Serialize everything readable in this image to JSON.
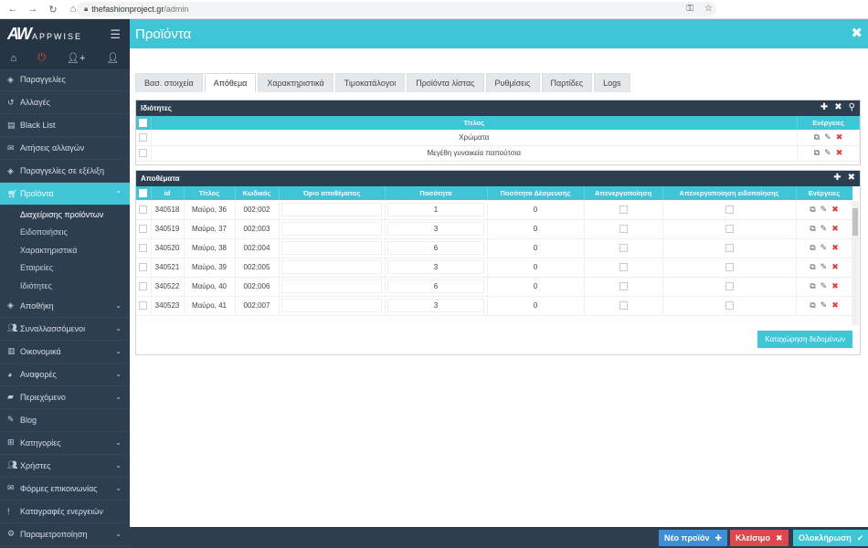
{
  "browser": {
    "url_host": "thefashionproject.gr",
    "url_path": "/admin"
  },
  "brand": {
    "mark": "AW",
    "word": "APPWISE"
  },
  "sidebar": {
    "items": [
      {
        "label": "Παραγγελίες",
        "icon": "cube-icon"
      },
      {
        "label": "Αλλαγές",
        "icon": "undo-icon"
      },
      {
        "label": "Black List",
        "icon": "list-icon"
      },
      {
        "label": "Αιτήσεις αλλαγών",
        "icon": "envelope-icon"
      },
      {
        "label": "Παραγγελίες σε εξέλιξη",
        "icon": "cube-icon"
      }
    ],
    "active": {
      "label": "Προϊόντα",
      "icon": "cart-icon"
    },
    "submenu": [
      "Διαχείρισης προϊόντων",
      "Ειδοποιήσεις",
      "Χαρακτηριστικά",
      "Εταιρείες",
      "Ιδιότητες"
    ],
    "items_after": [
      {
        "label": "Αποθήκη",
        "icon": "cube-icon",
        "chevron": true
      },
      {
        "label": "Συναλλασσόμενοι",
        "icon": "users-icon",
        "chevron": true
      },
      {
        "label": "Οικονομικά",
        "icon": "chart-icon",
        "chevron": true
      },
      {
        "label": "Αναφορές",
        "icon": "pie-icon",
        "chevron": true
      },
      {
        "label": "Περιεχόμενο",
        "icon": "folder-icon",
        "chevron": true
      },
      {
        "label": "Blog",
        "icon": "pencil-icon",
        "chevron": false
      },
      {
        "label": "Κατηγορίες",
        "icon": "sitemap-icon",
        "chevron": true
      },
      {
        "label": "Χρήστες",
        "icon": "users-icon",
        "chevron": true
      },
      {
        "label": "Φόρμες επικοινωνίας",
        "icon": "envelope-icon",
        "chevron": true
      },
      {
        "label": "Καταγραφές ενεργειών",
        "icon": "exclamation-icon",
        "chevron": false
      },
      {
        "label": "Παραμετροποίηση",
        "icon": "gears-icon",
        "chevron": true
      }
    ]
  },
  "header": {
    "title": "Προϊόντα"
  },
  "tabs": [
    "Βασ. στοιχεία",
    "Απόθεμα",
    "Χαρακτηριστικά",
    "Τιμοκατάλογοι",
    "Προϊόντα λίστας",
    "Ρυθμίσεις",
    "Παρτίδες",
    "Logs"
  ],
  "properties": {
    "title": "Ιδιότητες",
    "col_title": "Τίτλος",
    "col_actions": "Ενέργειες",
    "rows": [
      "Χρώματα",
      "Μεγέθη γυναικεία παπούτσια"
    ]
  },
  "stock": {
    "title": "Αποθέματα",
    "columns": [
      "id",
      "Τίτλος",
      "Κωδικός",
      "Όριο αποθέματος",
      "Ποσότητα",
      "Ποσότητα Δέσμευσης",
      "Απενεργοποίηση",
      "Απενεργοποίηση ειδοποίησης",
      "Ενέργειες"
    ],
    "rows": [
      {
        "id": "340518",
        "title": "Μαύρο, 36",
        "code": "002;002",
        "qty": "1",
        "reserved": "0"
      },
      {
        "id": "340519",
        "title": "Μαύρο, 37",
        "code": "002;003",
        "qty": "3",
        "reserved": "0"
      },
      {
        "id": "340520",
        "title": "Μαύρο, 38",
        "code": "002;004",
        "qty": "6",
        "reserved": "0"
      },
      {
        "id": "340521",
        "title": "Μαύρο, 39",
        "code": "002;005",
        "qty": "3",
        "reserved": "0"
      },
      {
        "id": "340522",
        "title": "Μαύρο, 40",
        "code": "002;006",
        "qty": "6",
        "reserved": "0"
      },
      {
        "id": "340523",
        "title": "Μαύρο, 41",
        "code": "002;007",
        "qty": "3",
        "reserved": "0"
      }
    ],
    "save_label": "Καταχώρηση δεδομένων"
  },
  "footer": {
    "new_label": "Νέο προϊόν",
    "close_label": "Κλείσιμο",
    "done_label": "Ολοκλήρωση"
  },
  "colors": {
    "accent": "#3ec5d6",
    "sidebar": "#2d3e50",
    "danger": "#e0474c",
    "primary": "#3e8ed6"
  }
}
